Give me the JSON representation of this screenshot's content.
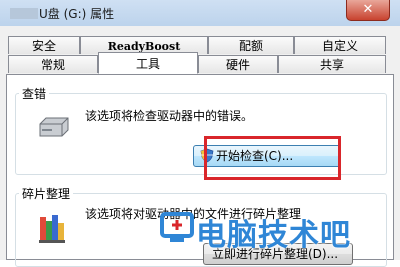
{
  "window": {
    "title": "U盘 (G:) 属性",
    "close_label": "✕"
  },
  "tabs_row1": [
    {
      "label": "安全"
    },
    {
      "label": "ReadyBoost"
    },
    {
      "label": "配额"
    },
    {
      "label": "自定义"
    }
  ],
  "tabs_row2": [
    {
      "label": "常规"
    },
    {
      "label": "工具",
      "active": true
    },
    {
      "label": "硬件"
    },
    {
      "label": "共享"
    }
  ],
  "error_check": {
    "group_label": "查错",
    "description": "该选项将检查驱动器中的错误。",
    "button_label": "开始检查(C)..."
  },
  "defrag": {
    "group_label": "碎片整理",
    "description": "该选项将对驱动器中的文件进行碎片整理",
    "button_label": "立即进行碎片整理(D)..."
  },
  "watermark": {
    "text": "电脑技术吧",
    "color": "#2f86d6"
  },
  "colors": {
    "highlight_box": "#d9262b",
    "close_button": "#c8432f"
  },
  "icons": [
    "drive-icon",
    "shield-icon",
    "defrag-icon",
    "watermark-logo-icon",
    "close-icon"
  ]
}
